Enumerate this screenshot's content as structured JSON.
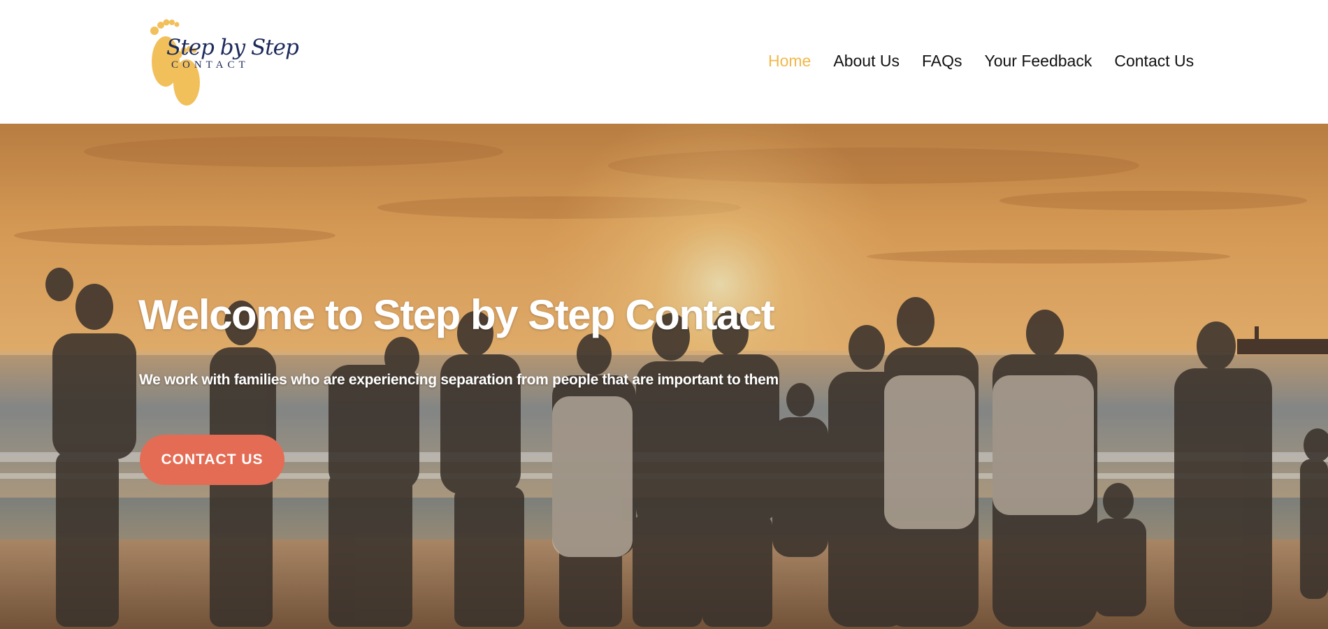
{
  "brand": {
    "logo_script": "Step by Step",
    "logo_sub": "CONTACT",
    "logo_color": "#f2c05a",
    "text_color": "#1d2a5c"
  },
  "nav": {
    "items": [
      {
        "label": "Home",
        "active": true
      },
      {
        "label": "About Us",
        "active": false
      },
      {
        "label": "FAQs",
        "active": false
      },
      {
        "label": "Your Feedback",
        "active": false
      },
      {
        "label": "Contact Us",
        "active": false
      }
    ],
    "active_color": "#f2b84a"
  },
  "hero": {
    "title": "Welcome to Step by Step Contact",
    "subtitle": "We work with families who are experiencing separation from people that are important to them",
    "cta_label": "CONTACT US",
    "cta_color": "#e46c54"
  }
}
